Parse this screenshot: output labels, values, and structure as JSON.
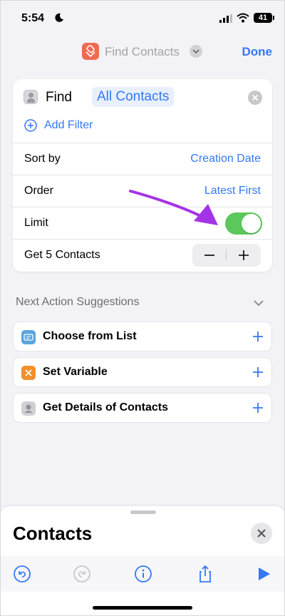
{
  "status_bar": {
    "time": "5:54",
    "battery": "41"
  },
  "nav": {
    "title": "Find Contacts",
    "done_label": "Done"
  },
  "action": {
    "find_label": "Find",
    "target_token": "All Contacts",
    "add_filter_label": "Add Filter",
    "rows": [
      {
        "label": "Sort by",
        "value": "Creation Date"
      },
      {
        "label": "Order",
        "value": "Latest First"
      },
      {
        "label": "Limit",
        "toggle_on": true
      },
      {
        "label": "Get 5 Contacts"
      }
    ]
  },
  "suggestions": {
    "title": "Next Action Suggestions",
    "items": [
      {
        "label": "Choose from List",
        "icon": "list-icon",
        "icon_color": "#5aa4e0"
      },
      {
        "label": "Set Variable",
        "icon": "variable-icon",
        "icon_color": "#f0912f"
      },
      {
        "label": "Get Details of Contacts",
        "icon": "contacts-icon",
        "icon_color": "#d0d0d4"
      }
    ]
  },
  "sheet": {
    "title": "Contacts"
  },
  "colors": {
    "accent": "#3478f6",
    "toggle_on": "#5bc85b",
    "annotation_arrow": "#a533e6"
  }
}
